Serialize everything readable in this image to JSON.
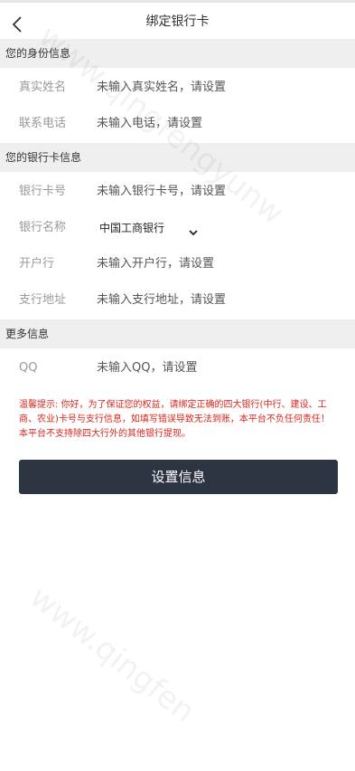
{
  "header": {
    "title": "绑定银行卡",
    "back_icon": "chevron-left-icon"
  },
  "sections": {
    "identity": "您的身份信息",
    "bank": "您的银行卡信息",
    "more": "更多信息"
  },
  "identity": {
    "name_label": "真实姓名",
    "name_value": "未输入真实姓名，请设置",
    "phone_label": "联系电话",
    "phone_value": "未输入电话，请设置"
  },
  "bank": {
    "card_label": "银行卡号",
    "card_value": "未输入银行卡号，请设置",
    "bank_name_label": "银行名称",
    "bank_name_selected": "中国工商银行",
    "branch_label": "开户行",
    "branch_value": "未输入开户行，请设置",
    "branch_address_label": "支行地址",
    "branch_address_value": "未输入支行地址，请设置"
  },
  "more": {
    "qq_label": "QQ",
    "qq_value": "未输入QQ，请设置"
  },
  "warning": "温馨提示: 你好，为了保证您的权益，请绑定正确的四大银行(中行、建设、工商、农业)卡号与支行信息，如填写错误导致无法到账，本平台不负任何责任！本平台不支持除四大行外的其他银行提现。",
  "submit_label": "设置信息",
  "colors": {
    "button_bg": "#2d3442",
    "section_bg": "#efefef",
    "warning": "#d9261c"
  }
}
